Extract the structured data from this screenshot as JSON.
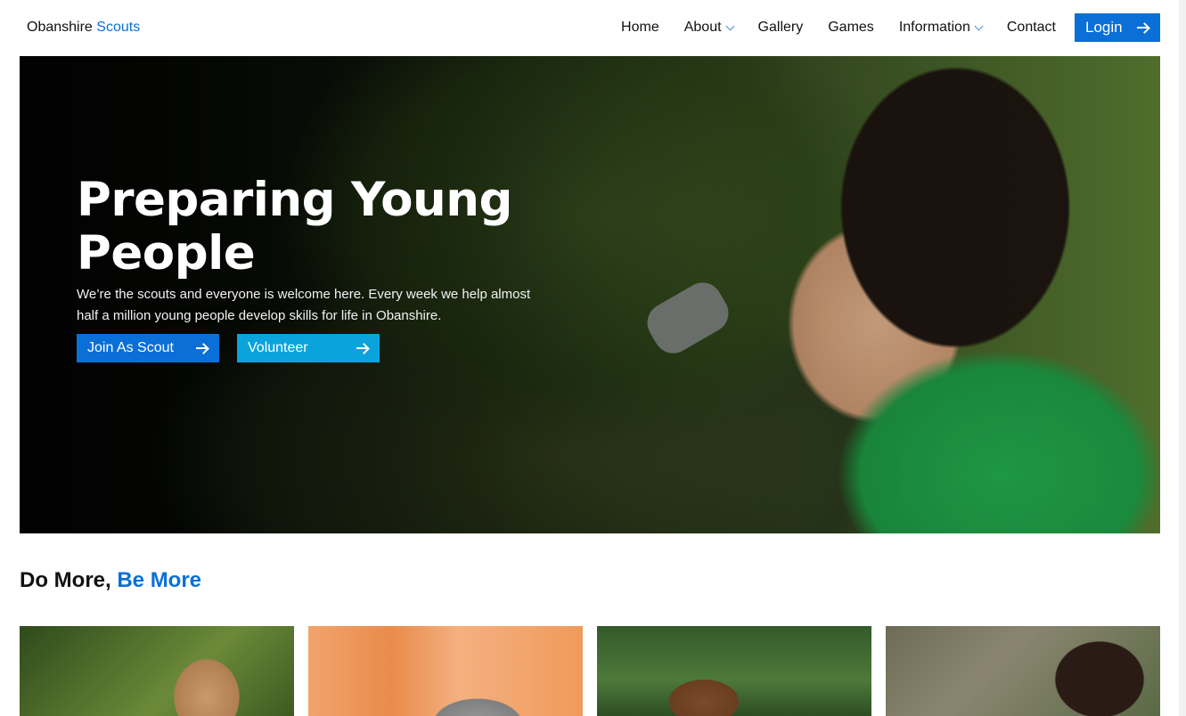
{
  "nav": {
    "brand_first": "Obanshire",
    "brand_second": "Scouts",
    "items": [
      {
        "label": "Home"
      },
      {
        "label": "About"
      },
      {
        "label": "Gallery"
      },
      {
        "label": "Games"
      },
      {
        "label": "Information"
      },
      {
        "label": "Contact"
      }
    ],
    "login_label": "Login"
  },
  "hero": {
    "title": "Preparing Young People",
    "text": "We’re the scouts and everyone is welcome here. Every week we help almost half a million young people develop skills for life in Obanshire.",
    "primary_button": "Join As Scout",
    "secondary_button": "Volunteer"
  },
  "section": {
    "title_first": "Do More,",
    "title_second": "Be More"
  },
  "colors": {
    "accent": "#0a6fd6",
    "secondary": "#0aa3dc"
  },
  "icons": {
    "arrow": "arrow-right-icon",
    "chevron": "chevron-down-icon"
  }
}
